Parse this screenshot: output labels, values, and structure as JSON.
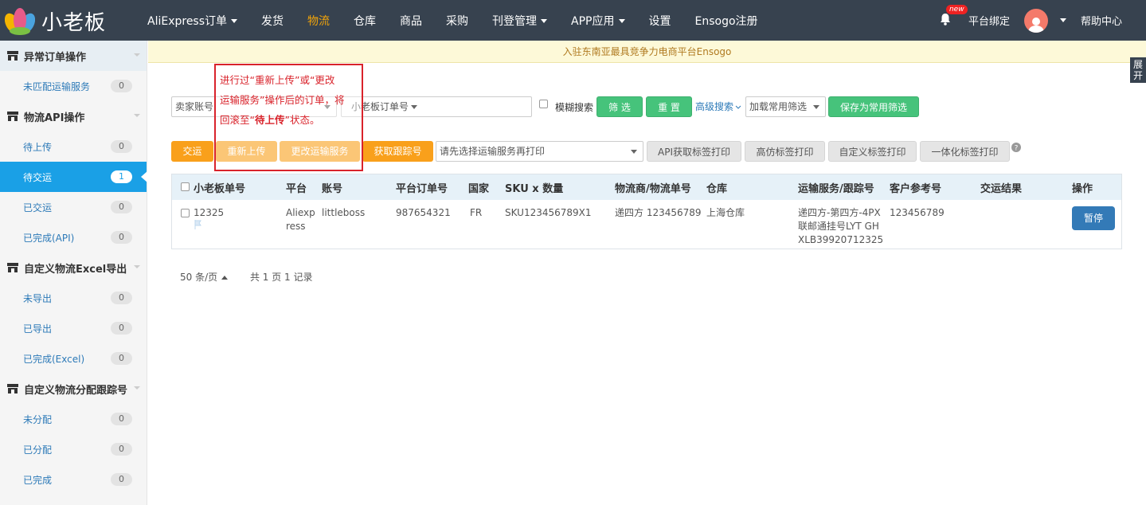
{
  "brand": {
    "name": "小老板"
  },
  "nav": {
    "items": [
      "AliExpress订单",
      "发货",
      "物流",
      "仓库",
      "商品",
      "采购",
      "刊登管理",
      "APP应用",
      "设置",
      "Ensogo注册"
    ]
  },
  "topright": {
    "badge": "new",
    "bind_label": "平台绑定",
    "help_label": "帮助中心"
  },
  "notice": "入驻东南亚最具竞争力电商平台Ensogo",
  "expand_tab": "展开",
  "sidebar": {
    "g0": {
      "title": "异常订单操作",
      "items": [
        {
          "label": "未匹配运输服务",
          "count": "0"
        }
      ]
    },
    "g1": {
      "title": "物流API操作",
      "items": [
        {
          "label": "待上传",
          "count": "0"
        },
        {
          "label": "待交运",
          "count": "1"
        },
        {
          "label": "已交运",
          "count": "0"
        },
        {
          "label": "已完成(API)",
          "count": "0"
        }
      ]
    },
    "g2": {
      "title": "自定义物流Excel导出",
      "items": [
        {
          "label": "未导出",
          "count": "0"
        },
        {
          "label": "已导出",
          "count": "0"
        },
        {
          "label": "已完成(Excel)",
          "count": "0"
        }
      ]
    },
    "g3": {
      "title": "自定义物流分配跟踪号",
      "items": [
        {
          "label": "未分配",
          "count": "0"
        },
        {
          "label": "已分配",
          "count": "0"
        },
        {
          "label": "已完成",
          "count": "0"
        }
      ]
    }
  },
  "filters": {
    "seller_select": "卖家账号",
    "order_select": "小老板订单号",
    "fuzzy_label": "模糊搜索",
    "filter_btn": "筛 选",
    "reset_btn": "重 置",
    "advanced": "高级搜索",
    "load_common": "加载常用筛选",
    "save_common": "保存为常用筛选"
  },
  "actions": {
    "ship": "交运",
    "reupload": "重新上传",
    "change_service": "更改运输服务",
    "get_tracking": "获取跟踪号",
    "print_select": "请先选择运输服务再打印",
    "api_label_print": "API获取标签打印",
    "hifi_label_print": "高仿标签打印",
    "custom_label_print": "自定义标签打印",
    "integrated_label_print": "一体化标签打印"
  },
  "callout": {
    "line1": "进行过“重新上传”或“更改",
    "line2": "运输服务”操作后的订单，将",
    "line3_pre": "回滚至“",
    "line3_bold": "待上传",
    "line3_post": "”状态。"
  },
  "table": {
    "headers": [
      "小老板单号",
      "平台",
      "账号",
      "平台订单号",
      "国家",
      "SKU x 数量",
      "物流商/物流单号",
      "仓库",
      "运输服务/跟踪号",
      "客户参考号",
      "交运结果",
      "操作"
    ],
    "row": {
      "order_no": "12325",
      "platform_l1": "Aliexp",
      "platform_l2": "ress",
      "account": "littleboss",
      "platform_order": "987654321",
      "country": "FR",
      "sku": "SKU123456789X1",
      "carrier": "递四方 123456789",
      "warehouse": "上海仓库",
      "service_l1": "递四方-第四方-4PX",
      "service_l2": "联邮通挂号LYT GH",
      "service_l3": "XLB39920712325",
      "customer_ref": "123456789",
      "result": "",
      "op_btn": "暂停"
    }
  },
  "pager": {
    "per_page": "50 条/页",
    "summary": "共 1 页 1 记录"
  }
}
